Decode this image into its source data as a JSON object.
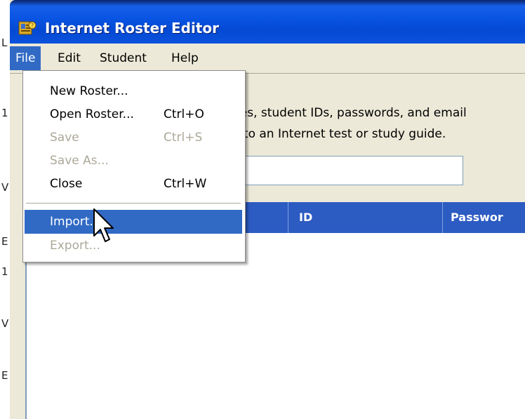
{
  "window": {
    "title": "Internet Roster Editor"
  },
  "menubar": {
    "items": [
      {
        "label": "File"
      },
      {
        "label": "Edit"
      },
      {
        "label": "Student"
      },
      {
        "label": "Help"
      }
    ]
  },
  "description": {
    "line1": "names, student IDs, passwords, and email",
    "line2": "cess to an Internet test or study guide."
  },
  "table": {
    "headers": [
      "ID",
      "Passwor"
    ]
  },
  "file_menu": {
    "items": [
      {
        "label": "New Roster...",
        "shortcut": "",
        "enabled": true
      },
      {
        "label": "Open Roster...",
        "shortcut": "Ctrl+O",
        "enabled": true
      },
      {
        "label": "Save",
        "shortcut": "Ctrl+S",
        "enabled": false
      },
      {
        "label": "Save As...",
        "shortcut": "",
        "enabled": false
      },
      {
        "label": "Close",
        "shortcut": "Ctrl+W",
        "enabled": true
      },
      {
        "label": "Import...",
        "shortcut": "",
        "enabled": true,
        "highlighted": true
      },
      {
        "label": "Export...",
        "shortcut": "",
        "enabled": false
      }
    ]
  },
  "background_fragments": [
    "L",
    "1",
    "V",
    "E",
    "1",
    "V",
    "E"
  ],
  "colors": {
    "title_bar": "#0a55e4",
    "menu_highlight": "#316ac5",
    "table_header": "#2c5bc2",
    "window_face": "#ece9d8",
    "disabled_text": "#aca899"
  },
  "icons": {
    "app": "roster-app-icon",
    "pointer": "mouse-pointer-icon"
  }
}
